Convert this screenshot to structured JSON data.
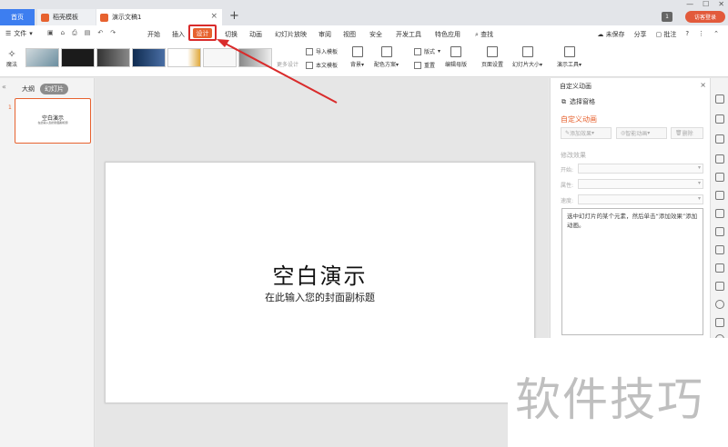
{
  "window": {
    "tabs": [
      {
        "label": "首页"
      },
      {
        "label": "稻壳模板"
      },
      {
        "label": "演示文稿1"
      }
    ],
    "new_tab": "+",
    "badge": "1",
    "login": "访客登录"
  },
  "menu": {
    "file": "文件",
    "items": [
      "开始",
      "插入",
      "设计",
      "切换",
      "动画",
      "幻灯片放映",
      "审阅",
      "视图",
      "安全",
      "开发工具",
      "特色应用",
      "查找"
    ],
    "active": "设计",
    "right": [
      "未保存",
      "分享",
      "批注"
    ]
  },
  "ribbon": {
    "magic": "魔法",
    "more_design": "更多设计",
    "import_template": "导入模板",
    "this_template": "本文模板",
    "background": "背景",
    "color_scheme": "配色方案",
    "layout": "版式",
    "reset": "重置",
    "edit_master": "编辑母版",
    "page_setup": "页面设置",
    "slide_size": "幻灯片大小",
    "present_tools": "演示工具"
  },
  "leftpanel": {
    "outline": "大纲",
    "slides": "幻灯片",
    "slide_number": "1",
    "thumb_title": "空白演示",
    "thumb_sub": "在此输入您的封面副标题"
  },
  "slide": {
    "title": "空白演示",
    "subtitle": "在此输入您的封面副标题"
  },
  "rightpanel": {
    "header": "自定义动画",
    "select_pane": "选择窗格",
    "custom_anim": "自定义动画",
    "add_effect": "添加效果",
    "smart_anim": "智能动画",
    "delete": "删除",
    "modify": "修改效果",
    "start": "开始:",
    "property": "属性:",
    "speed": "速度:",
    "info": "选中幻灯片的某个元素，然后单击“添加效果”添加动画。"
  },
  "watermark": "软件技巧",
  "colors": {
    "accent": "#e7622f",
    "highlight": "#d92b2b",
    "home_tab": "#3d7ef0"
  }
}
